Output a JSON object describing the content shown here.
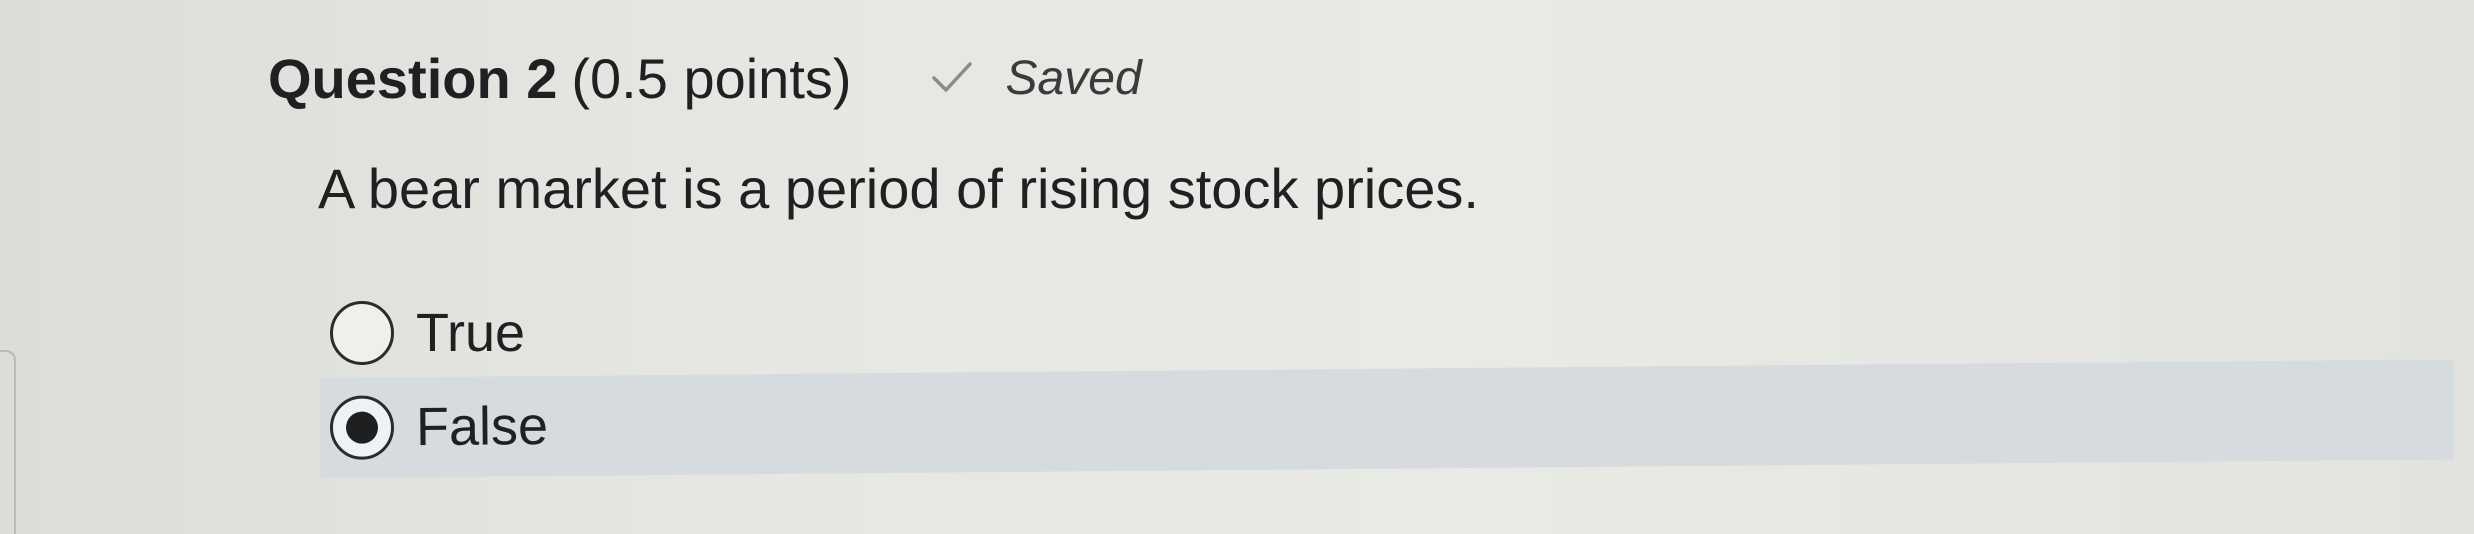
{
  "question": {
    "title": "Question 2",
    "points": "(0.5 points)",
    "status": "Saved",
    "status_icon": "check-icon",
    "text": "A bear market is a period of rising stock prices."
  },
  "options": [
    {
      "label": "True",
      "selected": false
    },
    {
      "label": "False",
      "selected": true
    }
  ],
  "colors": {
    "selected_row_bg": "#d6dbdf",
    "page_bg": "#e6e7e2"
  }
}
